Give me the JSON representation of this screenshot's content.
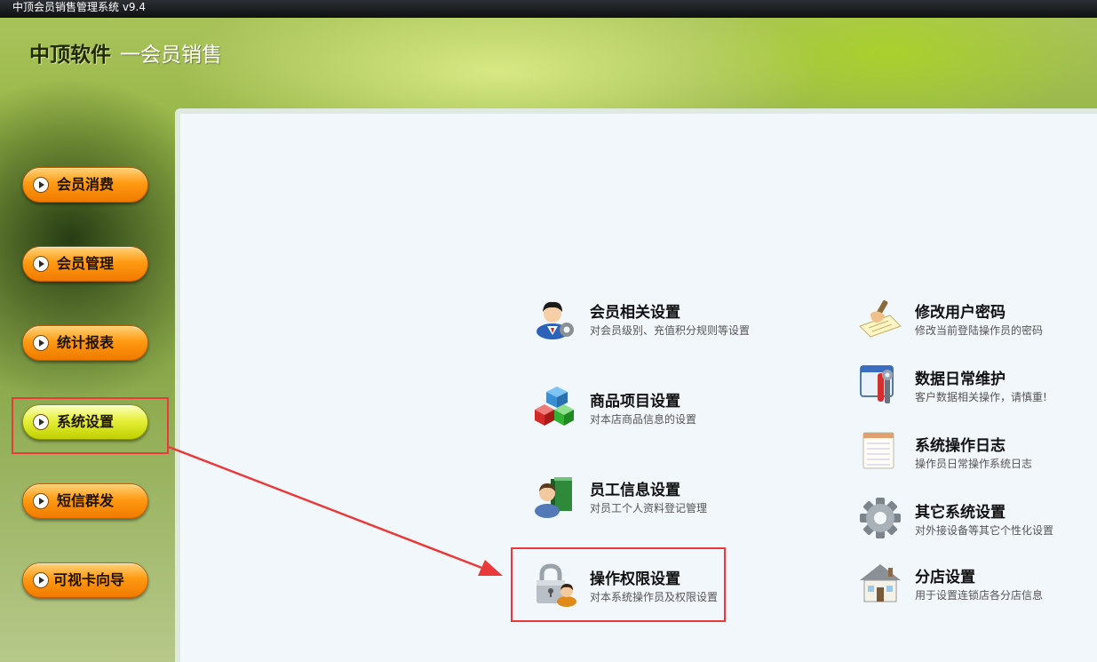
{
  "window": {
    "title": "中顶会员销售管理系统 v9.4"
  },
  "brand": {
    "main": "中顶软件",
    "sub": "一会员销售"
  },
  "sidebar": {
    "items": [
      {
        "label": "会员消费"
      },
      {
        "label": "会员管理"
      },
      {
        "label": "统计报表"
      },
      {
        "label": "系统设置",
        "active": true
      },
      {
        "label": "短信群发"
      },
      {
        "label": "可视卡向导"
      }
    ]
  },
  "settings": {
    "left": [
      {
        "title": "会员相关设置",
        "desc": "对会员级别、充值积分规则等设置",
        "icon": "member-settings-icon"
      },
      {
        "title": "商品项目设置",
        "desc": "对本店商品信息的设置",
        "icon": "product-cubes-icon"
      },
      {
        "title": "员工信息设置",
        "desc": "对员工个人资料登记管理",
        "icon": "employee-book-icon"
      },
      {
        "title": "操作权限设置",
        "desc": "对本系统操作员及权限设置",
        "icon": "lock-user-icon"
      }
    ],
    "right": [
      {
        "title": "修改用户密码",
        "desc": "修改当前登陆操作员的密码",
        "icon": "pen-paper-icon"
      },
      {
        "title": "数据日常维护",
        "desc": "客户数据相关操作，请慎重!",
        "icon": "tools-window-icon"
      },
      {
        "title": "系统操作日志",
        "desc": "操作员日常操作系统日志",
        "icon": "notepad-icon"
      },
      {
        "title": "其它系统设置",
        "desc": "对外接设备等其它个性化设置",
        "icon": "gear-icon"
      },
      {
        "title": "分店设置",
        "desc": "用于设置连锁店各分店信息",
        "icon": "house-icon"
      }
    ]
  },
  "colors": {
    "highlight": "#e83a3a",
    "sidebar_button": "#ff9a12",
    "sidebar_active": "#e6f03a",
    "content_bg": "#f1f7fb"
  }
}
